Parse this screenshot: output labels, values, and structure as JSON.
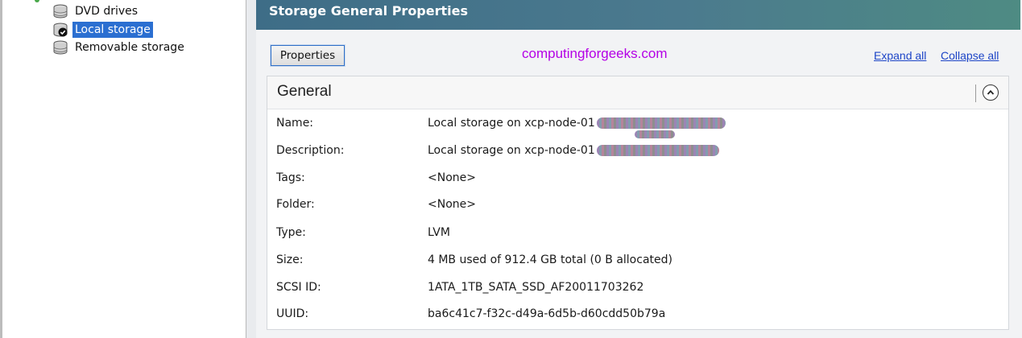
{
  "tree": {
    "items": [
      {
        "label": "DVD drives",
        "icon": "disk-icon"
      },
      {
        "label": "Local storage",
        "icon": "disk-check-icon",
        "selected": true
      },
      {
        "label": "Removable storage",
        "icon": "disk-icon"
      }
    ]
  },
  "panel": {
    "title": "Storage General Properties",
    "properties_button": "Properties",
    "watermark": "computingforgeeks.com",
    "expand_all": "Expand all",
    "collapse_all": "Collapse all",
    "section_title": "General",
    "fields": [
      {
        "key": "Name:",
        "value": "Local storage on xcp-node-01"
      },
      {
        "key": "Description:",
        "value": "Local storage on xcp-node-01"
      },
      {
        "key": "Tags:",
        "value": "<None>"
      },
      {
        "key": "Folder:",
        "value": "<None>"
      },
      {
        "key": "Type:",
        "value": "LVM"
      },
      {
        "key": "Size:",
        "value": "4 MB used of 912.4 GB total (0 B allocated)"
      },
      {
        "key": "SCSI ID:",
        "value": "1ATA_1TB_SATA_SSD_AF20011703262"
      },
      {
        "key": "UUID:",
        "value": "ba6c41c7-f32c-d49a-6d5b-d60cdd50b79a"
      }
    ]
  },
  "colors": {
    "header_gradient_start": "#3e6d87",
    "header_gradient_end": "#4e8b83",
    "selection": "#2b6fd1",
    "link": "#1d45c7",
    "watermark": "#b400e6"
  }
}
